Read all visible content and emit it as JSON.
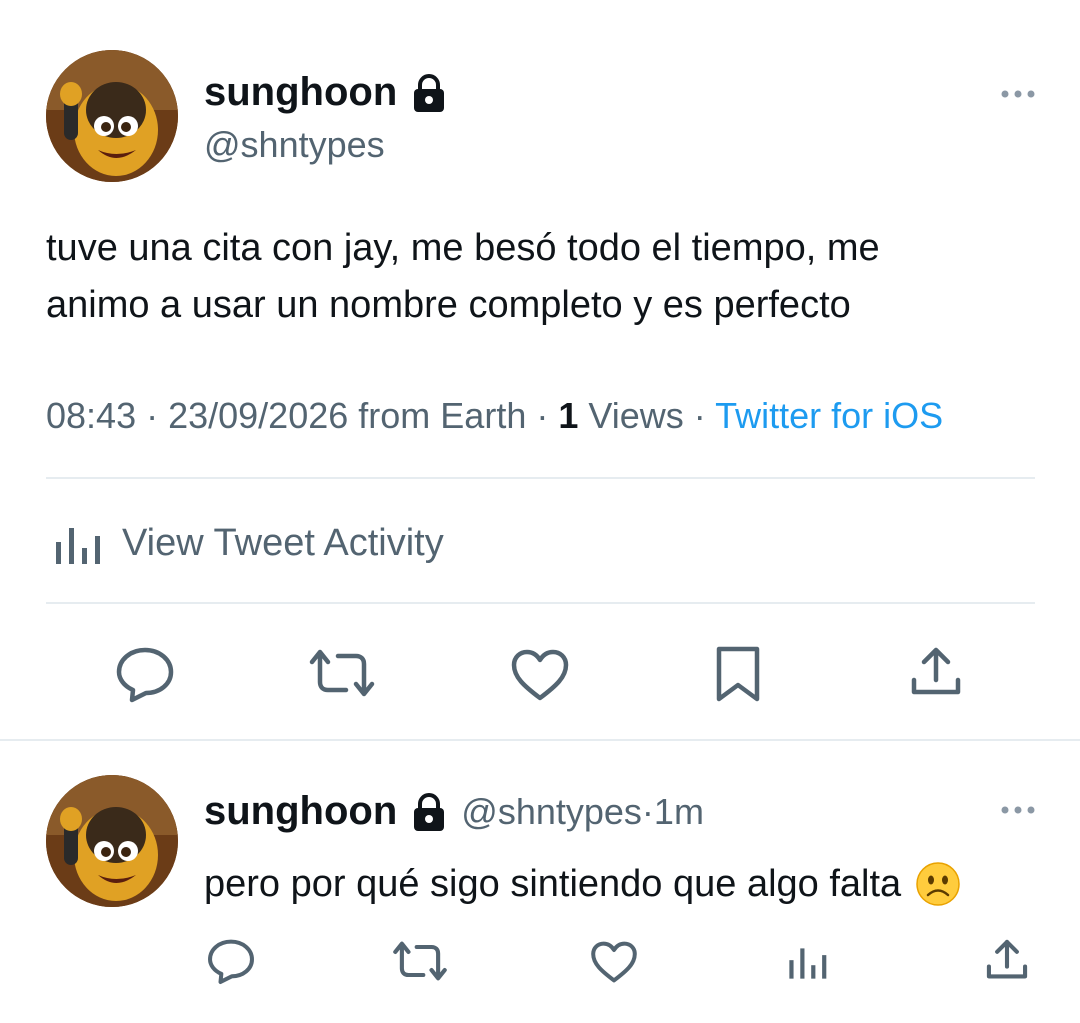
{
  "main_tweet": {
    "author_name": "sunghoon",
    "author_handle": "@shntypes",
    "lock_icon": "lock-icon",
    "more_icon": "more-icon",
    "text_line1": "tuve una cita con jay, me besó todo el tiempo, me",
    "text_line2": "animo a usar un nombre completo y es perfecto",
    "time": "08:43",
    "date": "23/09/2026",
    "location": "from Earth",
    "views_count": "1",
    "views_label": "Views",
    "source": "Twitter for iOS",
    "activity_label": "View Tweet Activity",
    "actions": [
      "reply-icon",
      "retweet-icon",
      "like-icon",
      "bookmark-icon",
      "share-icon"
    ]
  },
  "reply_tweet": {
    "author_name": "sunghoon",
    "author_handle": "@shntypes",
    "time_ago": "1m",
    "text": "pero por qué sigo sintiendo que algo falta",
    "emoji": "☹️",
    "actions": [
      "reply-icon",
      "retweet-icon",
      "like-icon",
      "views-icon",
      "share-icon"
    ]
  },
  "colors": {
    "text": "#0f1419",
    "secondary": "#536471",
    "link": "#1d9bf0",
    "divider": "#e6ecf0"
  }
}
